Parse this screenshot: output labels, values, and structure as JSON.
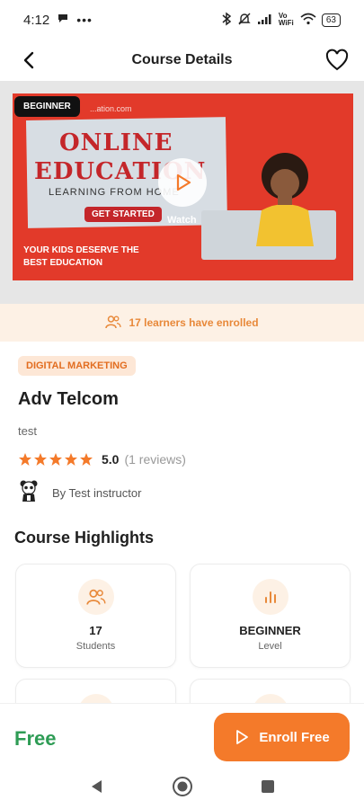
{
  "status_bar": {
    "time": "4:12",
    "battery": "63",
    "network_label": "Vo WiFi"
  },
  "header": {
    "title": "Course Details"
  },
  "media": {
    "level_badge": "BEGINNER",
    "watch_label": "Watch",
    "banner": {
      "site": "...ation.com",
      "headline_line1": "ONLINE",
      "headline_line2": "EDUCATION",
      "subheadline": "LEARNING FROM HOME",
      "cta": "GET STARTED",
      "tagline_line1": "YOUR KIDS DESERVE THE",
      "tagline_line2": "BEST EDUCATION"
    }
  },
  "enrolled_text": "17 learners have enrolled",
  "course": {
    "category": "DIGITAL MARKETING",
    "title": "Adv Telcom",
    "subtitle": "test",
    "rating": "5.0",
    "reviews": "(1 reviews)",
    "stars": 5,
    "instructor": "By Test instructor"
  },
  "highlights": {
    "title": "Course Highlights",
    "cards": [
      {
        "icon": "users-icon",
        "value": "17",
        "label": "Students"
      },
      {
        "icon": "bar-chart-icon",
        "value": "BEGINNER",
        "label": "Level"
      }
    ]
  },
  "footer": {
    "price": "Free",
    "enroll_label": "Enroll Free"
  },
  "colors": {
    "accent": "#f47a2a",
    "price_green": "#2e9c55",
    "enrolled_bg": "#fdf1e5"
  }
}
